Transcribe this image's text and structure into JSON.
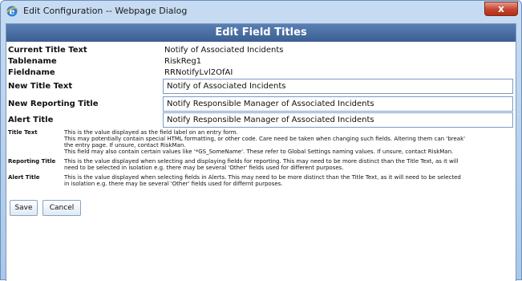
{
  "window": {
    "title": "Edit Configuration -- Webpage Dialog",
    "close_label": "x"
  },
  "header": {
    "title": "Edit Field Titles"
  },
  "info": {
    "current_title_label": "Current Title Text",
    "current_title_value": "Notify of Associated Incidents",
    "tablename_label": "Tablename",
    "tablename_value": "RiskReg1",
    "fieldname_label": "Fieldname",
    "fieldname_value": "RRNotifyLvl2OfAI"
  },
  "form": {
    "new_title_label": "New Title Text",
    "new_title_value": "Notify of Associated Incidents",
    "reporting_title_label": "New Reporting Title",
    "reporting_title_value": "Notify Responsible Manager of Associated Incidents",
    "alert_title_label": "Alert Title",
    "alert_title_value": "Notify Responsible Manager of Associated Incidents"
  },
  "help": {
    "title_text_label": "Title Text",
    "title_text_lines": [
      "This is the value displayed as the field label on an entry form.",
      "This may potentially contain special HTML formatting, or other code. Care need be taken when changing such fields. Altering them can 'break'",
      "the entry page. If unsure, contact RiskMan.",
      "This field may also contain certain values like '*GS_SomeName'. These refer to Global Settings naming values. If unsure, contact RiskMan."
    ],
    "reporting_title_label": "Reporting Title",
    "reporting_title_lines": [
      "This is the value displayed when selecting and displaying fields for reporting. This may need to be more distinct than the Title Text, as it will",
      "need to be selected in isolation e.g. there may be several 'Other' fields used for different purposes."
    ],
    "alert_title_label": "Alert Title",
    "alert_title_lines": [
      "This is the value displayed when selecting fields in Alerts. This may need to be more distinct than the Title Text, as it will need to be selected",
      "in isolation e.g. there may be several 'Other' fields used for differnt purposes."
    ]
  },
  "buttons": {
    "save_label": "Save",
    "cancel_label": "Cancel"
  },
  "colors": {
    "header_bar": "#4a6fa5",
    "frame": "#b7d0ee",
    "close_button": "#c7432d"
  },
  "icons": {
    "window_icon": "internet-explorer-icon",
    "close_icon": "close-icon"
  }
}
